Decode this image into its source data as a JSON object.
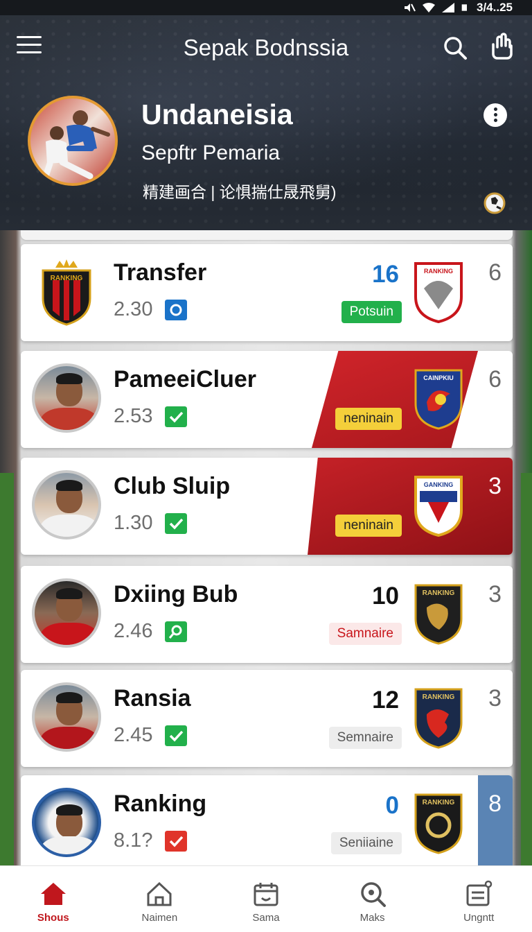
{
  "status_bar": {
    "time": "3/4..25"
  },
  "header": {
    "app_title": "Sepak Bodnssia",
    "team_name": "Undaneisia",
    "team_subtitle": "Sepftr Pemaria",
    "team_meta": "精建画合 | 论惧揣仕晟飛舅)"
  },
  "rows": [
    {
      "title": "Transfer",
      "value": "2.30",
      "check": "info",
      "score": "16",
      "score_color": "blue",
      "pill": "Potsuin",
      "pill_style": "green",
      "crest_text": "RANKING",
      "rank": "6",
      "left": "crest",
      "left_text": "RANKING"
    },
    {
      "title": "PameeiCluer",
      "value": "2.53",
      "check": "check",
      "score": "",
      "score_color": "dark",
      "pill": "neninain",
      "pill_style": "yellow",
      "crest_text": "CAINPKIU",
      "rank": "6",
      "left": "player"
    },
    {
      "title": "Club Sluip",
      "value": "1.30",
      "check": "check",
      "score": "",
      "score_color": "dark",
      "pill": "neninain",
      "pill_style": "yellow",
      "crest_text": "GANKING",
      "rank": "3",
      "left": "player"
    },
    {
      "title": "Dxiing Bub",
      "value": "2.46",
      "check": "search",
      "score": "10",
      "score_color": "dark",
      "pill": "Samnaire",
      "pill_style": "pink",
      "crest_text": "RANKING",
      "rank": "3",
      "left": "player"
    },
    {
      "title": "Ransia",
      "value": "2.45",
      "check": "check",
      "score": "12",
      "score_color": "dark",
      "pill": "Semnaire",
      "pill_style": "gray",
      "crest_text": "RANKING",
      "rank": "3",
      "left": "player"
    },
    {
      "title": "Ranking",
      "value": "8.1?",
      "check": "check-red",
      "score": "0",
      "score_color": "blue",
      "pill": "Seniiaine",
      "pill_style": "gray",
      "crest_text": "RANKING",
      "rank": "8",
      "left": "badge"
    }
  ],
  "bottom_nav": [
    {
      "label": "Shous",
      "icon": "home-filled-icon",
      "active": true
    },
    {
      "label": "Naimen",
      "icon": "home-outline-icon",
      "active": false
    },
    {
      "label": "Sama",
      "icon": "calendar-icon",
      "active": false
    },
    {
      "label": "Maks",
      "icon": "search-icon",
      "active": false
    },
    {
      "label": "Ungntt",
      "icon": "settings-list-icon",
      "active": false
    }
  ],
  "colors": {
    "accent_red": "#c0171d",
    "score_blue": "#1a73c9",
    "check_green": "#22b04b",
    "info_blue": "#1a73c9"
  }
}
